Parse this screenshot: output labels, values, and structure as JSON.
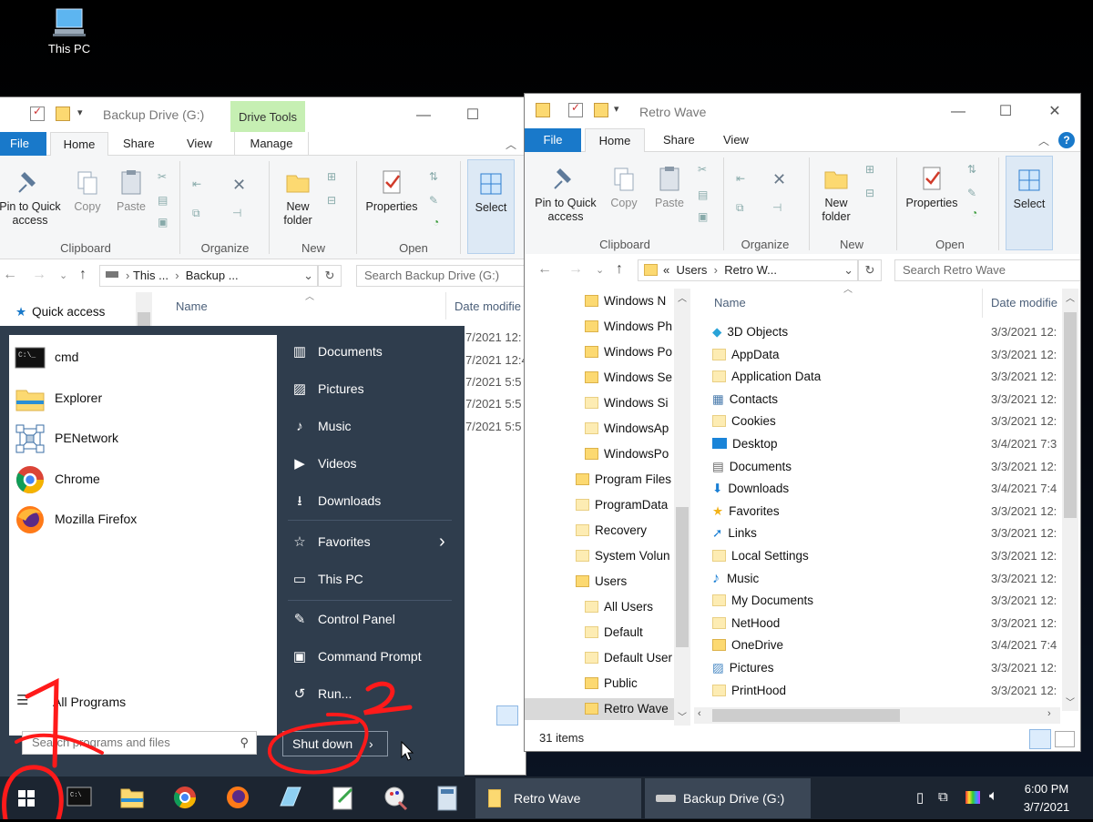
{
  "desktop": {
    "icon_label": "This PC"
  },
  "win1": {
    "title": "Backup Drive (G:)",
    "context_tab": "Drive Tools",
    "tabs": [
      "File",
      "Home",
      "Share",
      "View",
      "Manage"
    ],
    "ribbon": {
      "pin": "Pin to Quick access",
      "copy": "Copy",
      "paste": "Paste",
      "new_folder": "New folder",
      "properties": "Properties",
      "select": "Select",
      "groups": {
        "clipboard": "Clipboard",
        "organize": "Organize",
        "new": "New",
        "open": "Open"
      }
    },
    "address": {
      "seg1": "This ...",
      "seg2": "Backup ..."
    },
    "search_placeholder": "Search Backup Drive (G:)",
    "nav": {
      "quick_access": "Quick access"
    },
    "col_name": "Name",
    "col_date": "Date modifie",
    "dates": [
      "7/2021 12:",
      "7/2021 12:4",
      "7/2021 5:5",
      "7/2021 5:5",
      "7/2021 5:5"
    ]
  },
  "win2": {
    "title": "Retro Wave",
    "tabs": [
      "File",
      "Home",
      "Share",
      "View"
    ],
    "ribbon": {
      "pin": "Pin to Quick access",
      "copy": "Copy",
      "paste": "Paste",
      "new_folder": "New folder",
      "properties": "Properties",
      "select": "Select",
      "groups": {
        "clipboard": "Clipboard",
        "organize": "Organize",
        "new": "New",
        "open": "Open"
      }
    },
    "address": {
      "prefix": "«",
      "seg1": "Users",
      "seg2": "Retro W..."
    },
    "search_placeholder": "Search Retro Wave",
    "tree": [
      "Windows N",
      "Windows Ph",
      "Windows Po",
      "Windows Se",
      "Windows Si",
      "WindowsAp",
      "WindowsPo",
      "Program Files",
      "ProgramData",
      "Recovery",
      "System Volun",
      "Users",
      "All Users",
      "Default",
      "Default User",
      "Public",
      "Retro Wave"
    ],
    "col_name": "Name",
    "col_date": "Date modifie",
    "files": [
      {
        "name": "3D Objects",
        "date": "3/3/2021 12:"
      },
      {
        "name": "AppData",
        "date": "3/3/2021 12:"
      },
      {
        "name": "Application Data",
        "date": "3/3/2021 12:"
      },
      {
        "name": "Contacts",
        "date": "3/3/2021 12:"
      },
      {
        "name": "Cookies",
        "date": "3/3/2021 12:"
      },
      {
        "name": "Desktop",
        "date": "3/4/2021 7:3"
      },
      {
        "name": "Documents",
        "date": "3/3/2021 12:"
      },
      {
        "name": "Downloads",
        "date": "3/4/2021 7:4"
      },
      {
        "name": "Favorites",
        "date": "3/3/2021 12:"
      },
      {
        "name": "Links",
        "date": "3/3/2021 12:"
      },
      {
        "name": "Local Settings",
        "date": "3/3/2021 12:"
      },
      {
        "name": "Music",
        "date": "3/3/2021 12:"
      },
      {
        "name": "My Documents",
        "date": "3/3/2021 12:"
      },
      {
        "name": "NetHood",
        "date": "3/3/2021 12:"
      },
      {
        "name": "OneDrive",
        "date": "3/4/2021 7:4"
      },
      {
        "name": "Pictures",
        "date": "3/3/2021 12:"
      },
      {
        "name": "PrintHood",
        "date": "3/3/2021 12:"
      }
    ],
    "status": "31 items"
  },
  "start_menu": {
    "left": [
      "cmd",
      "Explorer",
      "PENetwork",
      "Chrome",
      "Mozilla Firefox"
    ],
    "all_programs": "All Programs",
    "search_placeholder": "Search programs and files",
    "right": [
      "Documents",
      "Pictures",
      "Music",
      "Videos",
      "Downloads",
      "Favorites",
      "This PC",
      "Control Panel",
      "Command Prompt",
      "Run..."
    ],
    "shutdown": "Shut down"
  },
  "taskbar": {
    "buttons": [
      "Retro Wave",
      "Backup Drive (G:)"
    ],
    "time": "6:00 PM",
    "date": "3/7/2021"
  },
  "annotations": [
    "1",
    "2"
  ],
  "colors": {
    "accent": "#1979ca",
    "start_bg": "#2f3d4d",
    "taskbar": "#1c2531",
    "annotation": "#ff1a1a"
  }
}
